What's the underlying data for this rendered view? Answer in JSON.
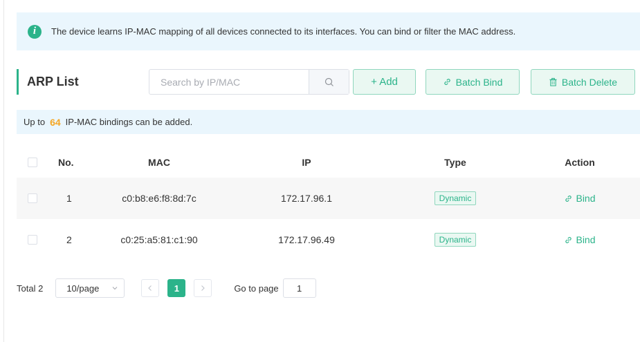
{
  "info_banner": {
    "icon": "info-icon",
    "text": "The device learns IP-MAC mapping of all devices connected to its interfaces. You can bind or filter the MAC address."
  },
  "header": {
    "title": "ARP List",
    "search_placeholder": "Search by IP/MAC",
    "search_value": "",
    "add_label": "+ Add",
    "batch_bind_label": "Batch Bind",
    "batch_delete_label": "Batch Delete"
  },
  "limit_notice": {
    "prefix": "Up to",
    "count": "64",
    "suffix": "IP-MAC bindings can be added."
  },
  "table": {
    "columns": [
      "No.",
      "MAC",
      "IP",
      "Type",
      "Action"
    ],
    "rows": [
      {
        "no": "1",
        "mac": "c0:b8:e6:f8:8d:7c",
        "ip": "172.17.96.1",
        "type": "Dynamic",
        "action": "Bind"
      },
      {
        "no": "2",
        "mac": "c0:25:a5:81:c1:90",
        "ip": "172.17.96.49",
        "type": "Dynamic",
        "action": "Bind"
      }
    ]
  },
  "pagination": {
    "total_label": "Total 2",
    "page_size": "10/page",
    "current_page": "1",
    "goto_label": "Go to page",
    "goto_value": "1"
  },
  "colors": {
    "accent": "#2bb38a",
    "banner_bg": "#eaf6fd",
    "highlight_number": "#f5a623"
  }
}
